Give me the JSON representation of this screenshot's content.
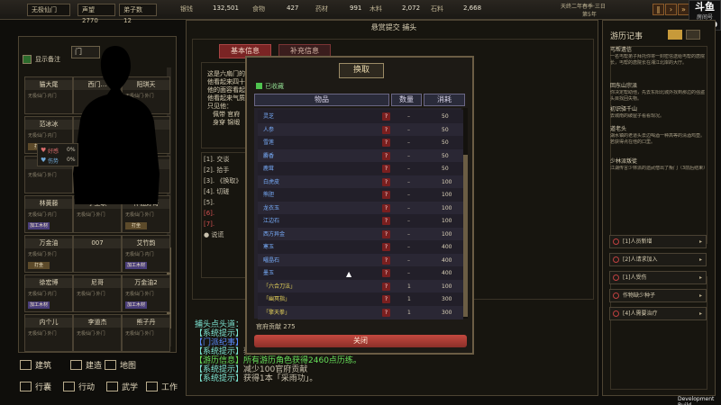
{
  "topbar": {
    "location": "无极仙门",
    "fame_label": "声望",
    "fame_value": "2770",
    "disciples_label": "弟子数",
    "disciples_value": "12",
    "res1_label": "银钱",
    "res1_value": "132,501",
    "res2_label": "食物",
    "res2_value": "427",
    "res3_label": "药材",
    "res3_value": "991",
    "res4_label": "木料",
    "res4_value": "2,072",
    "res5_label": "石料",
    "res5_value": "2,668",
    "date_text": "天终二年春季·三日",
    "date_sub": "第5年",
    "stream_badge": "斗鱼",
    "room_label": "房间号",
    "room_number": "36140"
  },
  "left_panel": {
    "toggle_label": "显示备注",
    "search_placeholder": "门",
    "characters": [
      {
        "name": "猫大尾",
        "sub": "无极仙门·内门",
        "tag": "",
        "tag_color": ""
      },
      {
        "name": "西门…",
        "sub": "",
        "tag": "",
        "tag_color": ""
      },
      {
        "name": "阳琪天",
        "sub": "无极仙门·外门",
        "tag": "",
        "tag_color": ""
      },
      {
        "name": "范冰冰",
        "sub": "无极仙门·内门",
        "tag": "打坐",
        "tag_color": "#5c4a2a"
      },
      {
        "name": "",
        "sub": "",
        "tag": "",
        "tag_color": ""
      },
      {
        "name": "",
        "sub": "",
        "tag": "",
        "tag_color": ""
      },
      {
        "name": "",
        "sub": "无极仙门·外门",
        "tag": "",
        "tag_color": ""
      },
      {
        "name": "",
        "sub": "",
        "tag": "",
        "tag_color": ""
      },
      {
        "name": "",
        "sub": "",
        "tag": "",
        "tag_color": ""
      },
      {
        "name": "林黄藤",
        "sub": "无极仙门·内门",
        "tag": "加工木材",
        "tag_color": "#4a3e7a"
      },
      {
        "name": "李工耿",
        "sub": "无极仙门·外门",
        "tag": "",
        "tag_color": ""
      },
      {
        "name": "神仙好哥",
        "sub": "无极仙门·外门",
        "tag": "打坐",
        "tag_color": "#5c4a2a"
      },
      {
        "name": "万金油",
        "sub": "无极仙门·外门",
        "tag": "打坐",
        "tag_color": "#5c4a2a"
      },
      {
        "name": "007",
        "sub": "",
        "tag": "",
        "tag_color": ""
      },
      {
        "name": "艾竹韵",
        "sub": "无极仙门·内门",
        "tag": "加工木材",
        "tag_color": "#4a3e7a"
      },
      {
        "name": "徐宏博",
        "sub": "无极仙门·内门",
        "tag": "加工木材",
        "tag_color": "#4a3e7a"
      },
      {
        "name": "尼哥",
        "sub": "无极仙门·外门",
        "tag": "",
        "tag_color": ""
      },
      {
        "name": "万金油2",
        "sub": "无极仙门·外门",
        "tag": "加工木材",
        "tag_color": "#4a3e7a"
      },
      {
        "name": "内个儿",
        "sub": "无极仙门·外门",
        "tag": "",
        "tag_color": ""
      },
      {
        "name": "李道杰",
        "sub": "无极仙门·外门",
        "tag": "",
        "tag_color": ""
      },
      {
        "name": "熊子丹",
        "sub": "无极仙门·外门",
        "tag": "",
        "tag_color": ""
      }
    ],
    "status_favor": "好感",
    "status_favor_value": "0%",
    "status_hurt": "伤势",
    "status_hurt_value": "0%"
  },
  "bottom_nav": {
    "build1": "建筑",
    "build2": "建造",
    "map": "地图",
    "travel": "行囊",
    "action": "行动",
    "martial": "武学",
    "work": "工作"
  },
  "dialog": {
    "header": "悬赏提交 捕头",
    "tab_basic": "基本信息",
    "tab_ext": "补充信息",
    "desc_line1": "这是六扇门的",
    "desc_line2": "他看起来四十",
    "desc_line3": "他的面容看起",
    "desc_line4": "他看起来气质",
    "desc_line5": "只见他：",
    "desc_line6": "佩带 官府",
    "desc_line7": "身穿 锦缎",
    "options": [
      {
        "text": "[1]. 交谈",
        "color": "#c9c1ad"
      },
      {
        "text": "[2]. 拾手",
        "color": "#c9c1ad"
      },
      {
        "text": "[3]. 《换取》",
        "color": "#c9c1ad"
      },
      {
        "text": "[4]. 切磋",
        "color": "#c9c1ad"
      },
      {
        "text": "[5]. ",
        "color": "#c9c1ad"
      },
      {
        "text": "[6]. ",
        "color": "#d05050"
      },
      {
        "text": "[7]. ",
        "color": "#d05050"
      },
      {
        "text": "● 说谎",
        "color": "#c9c1ad"
      }
    ]
  },
  "modal": {
    "title": "换取",
    "filter_label": "已收藏",
    "col_item": "物品",
    "col_count": "数量",
    "col_cost": "消耗",
    "rows": [
      {
        "name": "灵芝",
        "count": "–",
        "cost": "50",
        "color": "#7ab0ff"
      },
      {
        "name": "人参",
        "count": "–",
        "cost": "50",
        "color": "#7ab0ff"
      },
      {
        "name": "雪莲",
        "count": "–",
        "cost": "50",
        "color": "#7ab0ff"
      },
      {
        "name": "麝香",
        "count": "–",
        "cost": "50",
        "color": "#7ab0ff"
      },
      {
        "name": "鹿茸",
        "count": "–",
        "cost": "50",
        "color": "#7ab0ff"
      },
      {
        "name": "白虎皮",
        "count": "–",
        "cost": "100",
        "color": "#7ab0ff"
      },
      {
        "name": "熊胆",
        "count": "–",
        "cost": "100",
        "color": "#7ab0ff"
      },
      {
        "name": "龙衣玉",
        "count": "–",
        "cost": "100",
        "color": "#7ab0ff"
      },
      {
        "name": "江边石",
        "count": "–",
        "cost": "100",
        "color": "#7ab0ff"
      },
      {
        "name": "西方异金",
        "count": "–",
        "cost": "100",
        "color": "#7ab0ff"
      },
      {
        "name": "寒玉",
        "count": "–",
        "cost": "400",
        "color": "#7ab0ff"
      },
      {
        "name": "曜晶石",
        "count": "–",
        "cost": "400",
        "color": "#7ab0ff"
      },
      {
        "name": "墨玉",
        "count": "–",
        "cost": "400",
        "color": "#7ab0ff"
      },
      {
        "name": "「六合刀法」",
        "count": "1",
        "cost": "100",
        "color": "#e6d35a"
      },
      {
        "name": "「幽冥指」",
        "count": "1",
        "cost": "300",
        "color": "#e6d35a"
      },
      {
        "name": "「擎天拳」",
        "count": "1",
        "cost": "300",
        "color": "#e6d35a"
      }
    ],
    "contribution_label": "官府贡献",
    "contribution_value": "275",
    "close_label": "关闭"
  },
  "log": {
    "title": "捕头点头道：",
    "lines": [
      {
        "prefix": "【系统提示】",
        "text": "",
        "color": "#7ee6d4"
      },
      {
        "prefix": "【门派纪事】",
        "text": "",
        "color": "#5a8cff"
      },
      {
        "prefix": "【系统提示】",
        "text": "获得190官府贡献",
        "color": "#7ee6d4"
      },
      {
        "prefix": "【游历信息】",
        "text": "所有游历角色获得2460点历练。",
        "color": "#67e05a"
      },
      {
        "prefix": "【系统提示】",
        "text": "减少100官府贡献",
        "color": "#7ee6d4"
      },
      {
        "prefix": "【系统提示】",
        "text": "获得1本「采雨功」。",
        "color": "#7ee6d4"
      }
    ]
  },
  "right_panel": {
    "title": "游历记事",
    "entries": [
      {
        "head": "丐帮遗信",
        "body": "一名丐帮弟子拜托你将一封密信送给丐帮的唐院长，丐帮的唐院长在湘江北岸的大厅。"
      },
      {
        "head": "回东山宗派",
        "body": "你决定帮助他，先去东阳北城外找到那边的强盗头目找回失物。"
      },
      {
        "head": "初识驿千山",
        "body": "去城南的破屋子看看现况。"
      },
      {
        "head": "道老头",
        "body": "湖水镇的老道头去边喝酒一种高等的清酒鸡壶。若获得点在他的口里。"
      },
      {
        "head": "少林派叛徒",
        "body": "江湖传言少林派的遗武僧出了叛门（3前后结束）"
      }
    ],
    "buttons": [
      {
        "label": "[1]人员新增",
        "kind": "alert"
      },
      {
        "label": "[2]人请求加入",
        "kind": "alert"
      },
      {
        "label": "[1]人受伤",
        "kind": "alert"
      },
      {
        "label": "作物缺少种子",
        "kind": "alert"
      },
      {
        "label": "[4]人需要治疗",
        "kind": "alert"
      }
    ]
  },
  "footer": {
    "dev_build": "Development Build"
  }
}
